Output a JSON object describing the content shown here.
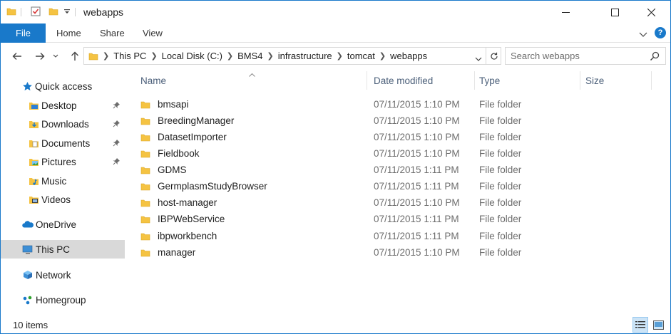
{
  "window": {
    "title": "webapps",
    "minimize_glyph": "—",
    "maximize_glyph": "☐",
    "close_glyph": "✕",
    "accent_color": "#1979ca"
  },
  "ribbon": {
    "tabs": [
      "File",
      "Home",
      "Share",
      "View"
    ],
    "help_glyph": "?"
  },
  "address": {
    "crumbs": [
      "This PC",
      "Local Disk (C:)",
      "BMS4",
      "infrastructure",
      "tomcat",
      "webapps"
    ]
  },
  "search": {
    "placeholder": "Search webapps"
  },
  "nav": {
    "quick_access": "Quick access",
    "items": [
      {
        "label": "Desktop",
        "icon": "desktop-icon",
        "pinned": true
      },
      {
        "label": "Downloads",
        "icon": "downloads-icon",
        "pinned": true
      },
      {
        "label": "Documents",
        "icon": "documents-icon",
        "pinned": true
      },
      {
        "label": "Pictures",
        "icon": "pictures-icon",
        "pinned": true
      },
      {
        "label": "Music",
        "icon": "music-icon",
        "pinned": false
      },
      {
        "label": "Videos",
        "icon": "videos-icon",
        "pinned": false
      }
    ],
    "onedrive": "OneDrive",
    "this_pc": "This PC",
    "network": "Network",
    "homegroup": "Homegroup"
  },
  "columns": {
    "name": "Name",
    "date": "Date modified",
    "type": "Type",
    "size": "Size"
  },
  "files": [
    {
      "name": "bmsapi",
      "date": "07/11/2015 1:10 PM",
      "type": "File folder"
    },
    {
      "name": "BreedingManager",
      "date": "07/11/2015 1:10 PM",
      "type": "File folder"
    },
    {
      "name": "DatasetImporter",
      "date": "07/11/2015 1:10 PM",
      "type": "File folder"
    },
    {
      "name": "Fieldbook",
      "date": "07/11/2015 1:10 PM",
      "type": "File folder"
    },
    {
      "name": "GDMS",
      "date": "07/11/2015 1:11 PM",
      "type": "File folder"
    },
    {
      "name": "GermplasmStudyBrowser",
      "date": "07/11/2015 1:11 PM",
      "type": "File folder"
    },
    {
      "name": "host-manager",
      "date": "07/11/2015 1:10 PM",
      "type": "File folder"
    },
    {
      "name": "IBPWebService",
      "date": "07/11/2015 1:11 PM",
      "type": "File folder"
    },
    {
      "name": "ibpworkbench",
      "date": "07/11/2015 1:11 PM",
      "type": "File folder"
    },
    {
      "name": "manager",
      "date": "07/11/2015 1:10 PM",
      "type": "File folder"
    }
  ],
  "status": {
    "item_count": "10 items"
  }
}
